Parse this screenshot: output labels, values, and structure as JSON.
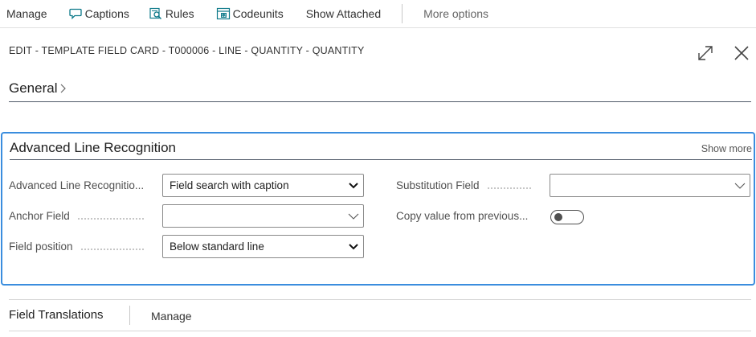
{
  "toolbar": {
    "manage": "Manage",
    "captions": "Captions",
    "rules": "Rules",
    "codeunits": "Codeunits",
    "show_attached": "Show Attached",
    "more_options": "More options"
  },
  "card": {
    "title": "EDIT - TEMPLATE FIELD CARD - T000006 - LINE - QUANTITY - QUANTITY",
    "general_label": "General"
  },
  "advanced": {
    "title": "Advanced Line Recognition",
    "show_more": "Show more",
    "fields": {
      "adv_line_recognition": {
        "label": "Advanced Line Recognitio...",
        "value": "Field search with caption"
      },
      "anchor_field": {
        "label": "Anchor Field",
        "value": ""
      },
      "field_position": {
        "label": "Field position",
        "value": "Below standard line"
      },
      "substitution_field": {
        "label": "Substitution Field",
        "value": ""
      },
      "copy_value": {
        "label": "Copy value from previous...",
        "checked": false
      }
    }
  },
  "translations": {
    "title": "Field Translations",
    "manage": "Manage"
  },
  "colors": {
    "focus_border": "#3a8dde",
    "divider": "#505a69",
    "icon_teal": "#0e7a8a"
  }
}
